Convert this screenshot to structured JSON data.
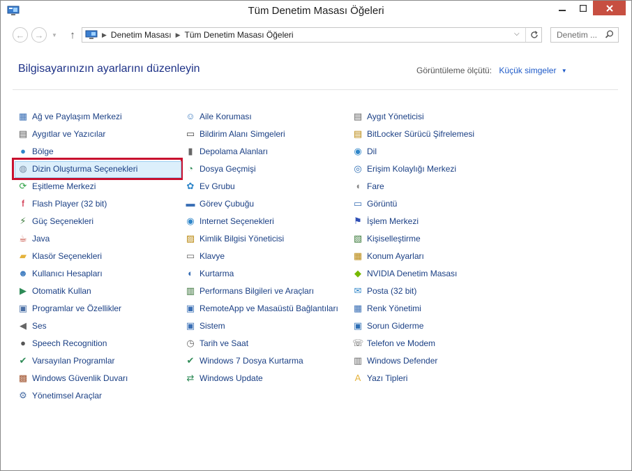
{
  "window": {
    "title": "Tüm Denetim Masası Öğeleri"
  },
  "address": {
    "breadcrumbs": [
      "Denetim Masası",
      "Tüm Denetim Masası Öğeleri"
    ]
  },
  "search": {
    "placeholder": "Denetim ..."
  },
  "header": {
    "title": "Bilgisayarınızın ayarlarını düzenleyin",
    "view_by_label": "Görüntüleme ölçütü:",
    "view_by_value": "Küçük simgeler"
  },
  "selected_item": "Dizin Oluşturma Seçenekleri",
  "accent_colors": {
    "link": "#1a3f84",
    "title": "#1e3287",
    "highlight_box": "#c8102e",
    "close_button": "#c74f41"
  },
  "columns": [
    [
      {
        "label": "Ağ ve Paylaşım Merkezi",
        "icon": "network-icon"
      },
      {
        "label": "Aygıtlar ve Yazıcılar",
        "icon": "printer-icon"
      },
      {
        "label": "Bölge",
        "icon": "globe-icon"
      },
      {
        "label": "Dizin Oluşturma Seçenekleri",
        "icon": "indexing-icon"
      },
      {
        "label": "Eşitleme Merkezi",
        "icon": "sync-icon"
      },
      {
        "label": "Flash Player (32 bit)",
        "icon": "flash-icon"
      },
      {
        "label": "Güç Seçenekleri",
        "icon": "power-icon"
      },
      {
        "label": "Java",
        "icon": "java-icon"
      },
      {
        "label": "Klasör Seçenekleri",
        "icon": "folder-icon"
      },
      {
        "label": "Kullanıcı Hesapları",
        "icon": "users-icon"
      },
      {
        "label": "Otomatik Kullan",
        "icon": "autoplay-icon"
      },
      {
        "label": "Programlar ve Özellikler",
        "icon": "programs-icon"
      },
      {
        "label": "Ses",
        "icon": "speaker-icon"
      },
      {
        "label": "Speech Recognition",
        "icon": "microphone-icon"
      },
      {
        "label": "Varsayılan Programlar",
        "icon": "default-programs-icon"
      },
      {
        "label": "Windows Güvenlik Duvarı",
        "icon": "firewall-icon"
      },
      {
        "label": "Yönetimsel Araçlar",
        "icon": "admin-tools-icon"
      }
    ],
    [
      {
        "label": "Aile Koruması",
        "icon": "family-icon"
      },
      {
        "label": "Bildirim Alanı Simgeleri",
        "icon": "notification-icon"
      },
      {
        "label": "Depolama Alanları",
        "icon": "storage-icon"
      },
      {
        "label": "Dosya Geçmişi",
        "icon": "file-history-icon"
      },
      {
        "label": "Ev Grubu",
        "icon": "homegroup-icon"
      },
      {
        "label": "Görev Çubuğu",
        "icon": "taskbar-icon"
      },
      {
        "label": "Internet Seçenekleri",
        "icon": "internet-icon"
      },
      {
        "label": "Kimlik Bilgisi Yöneticisi",
        "icon": "credential-icon"
      },
      {
        "label": "Klavye",
        "icon": "keyboard-icon"
      },
      {
        "label": "Kurtarma",
        "icon": "recovery-icon"
      },
      {
        "label": "Performans Bilgileri ve Araçları",
        "icon": "performance-icon"
      },
      {
        "label": "RemoteApp ve Masaüstü Bağlantıları",
        "icon": "remoteapp-icon"
      },
      {
        "label": "Sistem",
        "icon": "system-icon"
      },
      {
        "label": "Tarih ve Saat",
        "icon": "clock-icon"
      },
      {
        "label": "Windows 7 Dosya Kurtarma",
        "icon": "win7-recovery-icon"
      },
      {
        "label": "Windows Update",
        "icon": "update-icon"
      }
    ],
    [
      {
        "label": "Aygıt Yöneticisi",
        "icon": "device-manager-icon"
      },
      {
        "label": "BitLocker Sürücü Şifrelemesi",
        "icon": "bitlocker-icon"
      },
      {
        "label": "Dil",
        "icon": "language-icon"
      },
      {
        "label": "Erişim Kolaylığı Merkezi",
        "icon": "accessibility-icon"
      },
      {
        "label": "Fare",
        "icon": "mouse-icon"
      },
      {
        "label": "Görüntü",
        "icon": "display-icon"
      },
      {
        "label": "İşlem Merkezi",
        "icon": "flag-icon"
      },
      {
        "label": "Kişiselleştirme",
        "icon": "personalization-icon"
      },
      {
        "label": "Konum Ayarları",
        "icon": "location-icon"
      },
      {
        "label": "NVIDIA Denetim Masası",
        "icon": "nvidia-icon"
      },
      {
        "label": "Posta (32 bit)",
        "icon": "mail-icon"
      },
      {
        "label": "Renk Yönetimi",
        "icon": "color-icon"
      },
      {
        "label": "Sorun Giderme",
        "icon": "troubleshoot-icon"
      },
      {
        "label": "Telefon ve Modem",
        "icon": "phone-icon"
      },
      {
        "label": "Windows Defender",
        "icon": "defender-icon"
      },
      {
        "label": "Yazı Tipleri",
        "icon": "fonts-icon"
      }
    ]
  ]
}
